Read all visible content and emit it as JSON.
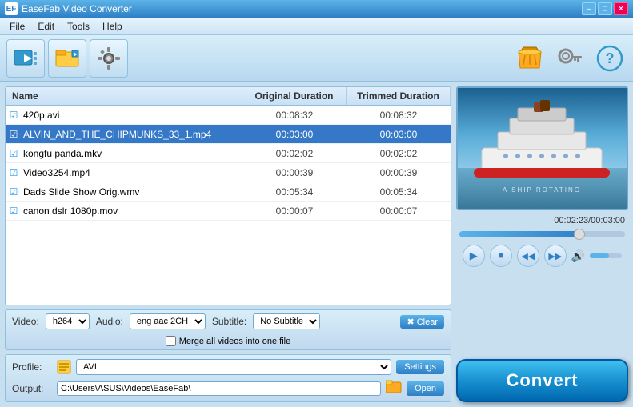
{
  "app": {
    "title": "EaseFab Video Converter",
    "icon": "EF"
  },
  "title_bar": {
    "min_label": "–",
    "max_label": "□",
    "close_label": "✕"
  },
  "menu": {
    "items": [
      "File",
      "Edit",
      "Tools",
      "Help"
    ]
  },
  "toolbar": {
    "btn1_icon": "📹",
    "btn2_icon": "🎬",
    "btn3_icon": "⚙️",
    "basket_icon": "🛒",
    "key_icon": "🔑",
    "help_icon": "⊙"
  },
  "file_list": {
    "col_name": "Name",
    "col_orig": "Original Duration",
    "col_trim": "Trimmed Duration",
    "files": [
      {
        "name": "420p.avi",
        "orig": "00:08:32",
        "trim": "00:08:32",
        "checked": true,
        "selected": false
      },
      {
        "name": "ALVIN_AND_THE_CHIPMUNKS_33_1.mp4",
        "orig": "00:03:00",
        "trim": "00:03:00",
        "checked": true,
        "selected": true
      },
      {
        "name": "kongfu panda.mkv",
        "orig": "00:02:02",
        "trim": "00:02:02",
        "checked": true,
        "selected": false
      },
      {
        "name": "Video3254.mp4",
        "orig": "00:00:39",
        "trim": "00:00:39",
        "checked": true,
        "selected": false
      },
      {
        "name": "Dads Slide Show Orig.wmv",
        "orig": "00:05:34",
        "trim": "00:05:34",
        "checked": true,
        "selected": false
      },
      {
        "name": "canon dslr 1080p.mov",
        "orig": "00:00:07",
        "trim": "00:00:07",
        "checked": true,
        "selected": false
      }
    ]
  },
  "controls": {
    "video_label": "Video:",
    "video_value": "h264",
    "audio_label": "Audio:",
    "audio_value": "eng aac 2CH",
    "subtitle_label": "Subtitle:",
    "subtitle_value": "No Subtitle",
    "clear_label": "✖ Clear",
    "merge_label": "Merge all videos into one file"
  },
  "profile": {
    "label": "Profile:",
    "value": "AVI",
    "settings_label": "Settings"
  },
  "output": {
    "label": "Output:",
    "path": "C:\\Users\\ASUS\\Videos\\EaseFab\\",
    "open_label": "Open"
  },
  "preview": {
    "time_display": "00:02:23/00:03:00",
    "progress_pct": 76,
    "volume_pct": 60
  },
  "player_controls": {
    "play": "▶",
    "stop": "■",
    "prev": "◀◀",
    "next": "▶▶",
    "volume": "🔊"
  },
  "convert": {
    "label": "Convert"
  }
}
